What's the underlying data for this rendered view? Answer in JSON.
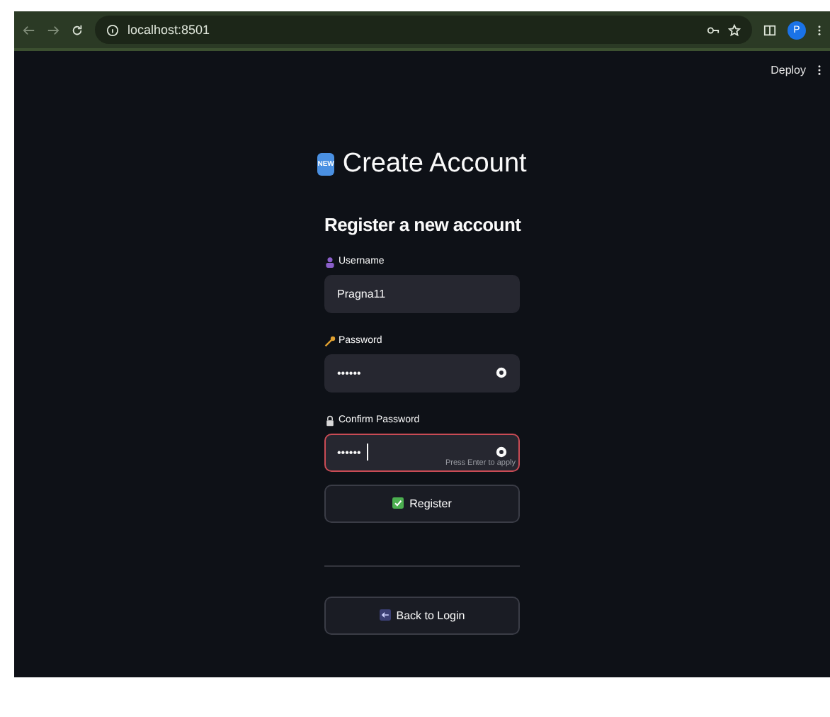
{
  "browser": {
    "url": "localhost:8501",
    "profile_initial": "P"
  },
  "toolbar": {
    "deploy": "Deploy"
  },
  "header": {
    "badge": "NEW",
    "title": "Create Account"
  },
  "subtitle": "Register a new account",
  "fields": [
    {
      "kind": "text",
      "label": "Username",
      "value": "Pragna11",
      "focused": false
    },
    {
      "kind": "password",
      "label": "Password",
      "value": "••••••",
      "focused": false
    },
    {
      "kind": "password",
      "label": "Confirm Password",
      "value": "••••••",
      "focused": true,
      "hint": "Press Enter to apply"
    }
  ],
  "register_button": "Register",
  "back_button": "Back to Login"
}
